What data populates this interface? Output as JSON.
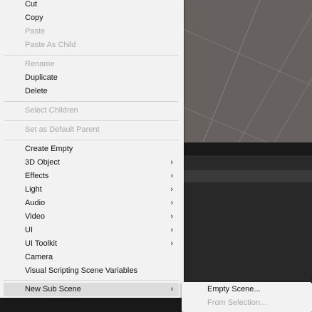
{
  "context_menu": {
    "items": [
      {
        "label": "Cut",
        "enabled": true
      },
      {
        "label": "Copy",
        "enabled": true
      },
      {
        "label": "Paste",
        "enabled": false
      },
      {
        "label": "Paste As Child",
        "enabled": false
      },
      {
        "label": "Rename",
        "enabled": false
      },
      {
        "label": "Duplicate",
        "enabled": true
      },
      {
        "label": "Delete",
        "enabled": true
      },
      {
        "label": "Select Children",
        "enabled": false
      },
      {
        "label": "Set as Default Parent",
        "enabled": false
      },
      {
        "label": "Create Empty",
        "enabled": true
      },
      {
        "label": "3D Object",
        "enabled": true,
        "submenu": true
      },
      {
        "label": "Effects",
        "enabled": true,
        "submenu": true
      },
      {
        "label": "Light",
        "enabled": true,
        "submenu": true
      },
      {
        "label": "Audio",
        "enabled": true,
        "submenu": true
      },
      {
        "label": "Video",
        "enabled": true,
        "submenu": true
      },
      {
        "label": "UI",
        "enabled": true,
        "submenu": true
      },
      {
        "label": "UI Toolkit",
        "enabled": true,
        "submenu": true
      },
      {
        "label": "Camera",
        "enabled": true
      },
      {
        "label": "Visual Scripting Scene Variables",
        "enabled": true
      },
      {
        "label": "New Sub Scene",
        "enabled": true,
        "submenu": true,
        "highlighted": true
      }
    ],
    "submenu_arrow": "›"
  },
  "submenu": {
    "items": [
      {
        "label": "Empty Scene...",
        "enabled": true
      },
      {
        "label": "From Selection...",
        "enabled": false
      }
    ]
  },
  "colors": {
    "menu_background": "#f2f2f2",
    "highlight": "#dcdcdc",
    "disabled_text": "#a8a8a8",
    "scene_background": "#676260"
  }
}
